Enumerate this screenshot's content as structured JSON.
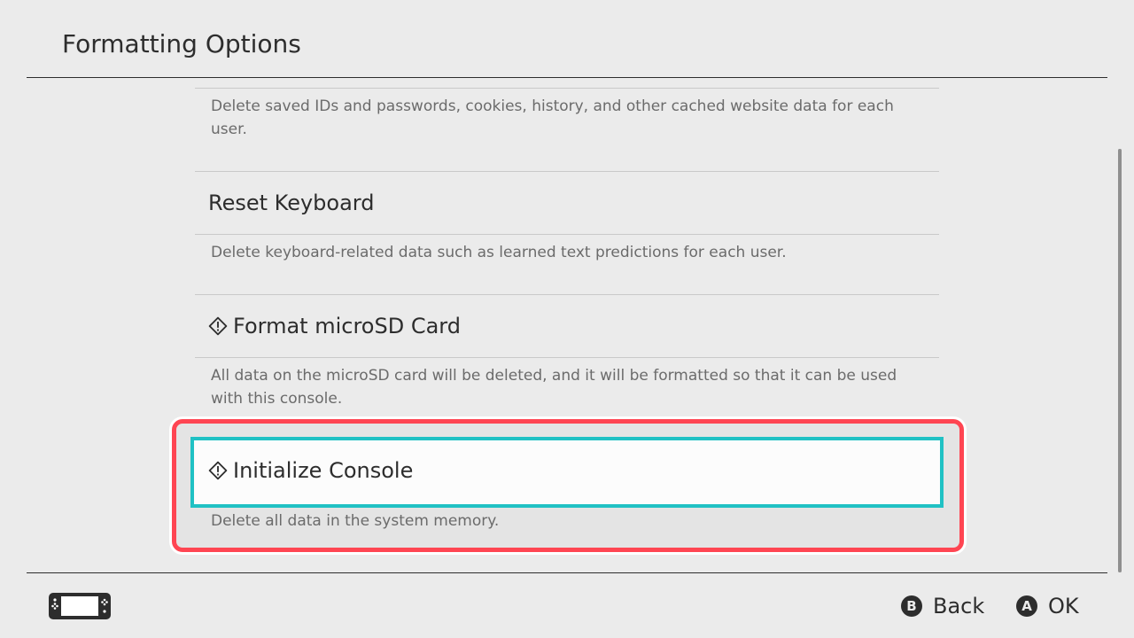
{
  "header": {
    "title": "Formatting Options"
  },
  "items": [
    {
      "description": "Delete saved IDs and passwords, cookies, history, and other cached website data for each user."
    },
    {
      "title": "Reset Keyboard",
      "description": "Delete keyboard-related data such as learned text predictions for each user."
    },
    {
      "title": "Format microSD Card",
      "icon": "warning-diamond-icon",
      "description": "All data on the microSD card will be deleted, and it will be formatted so that it can be used with this console."
    },
    {
      "title": "Initialize Console",
      "icon": "warning-diamond-icon",
      "description": "Delete all data in the system memory.",
      "selected": true
    }
  ],
  "footer": {
    "console_icon": "handheld-console-icon",
    "back": {
      "glyph": "B",
      "label": "Back"
    },
    "ok": {
      "glyph": "A",
      "label": "OK"
    }
  },
  "colors": {
    "background": "#ebebeb",
    "text": "#2d2d2d",
    "description": "#6b6b6b",
    "selection_border": "#20c1c4",
    "highlight_annotation": "#ff4552"
  }
}
